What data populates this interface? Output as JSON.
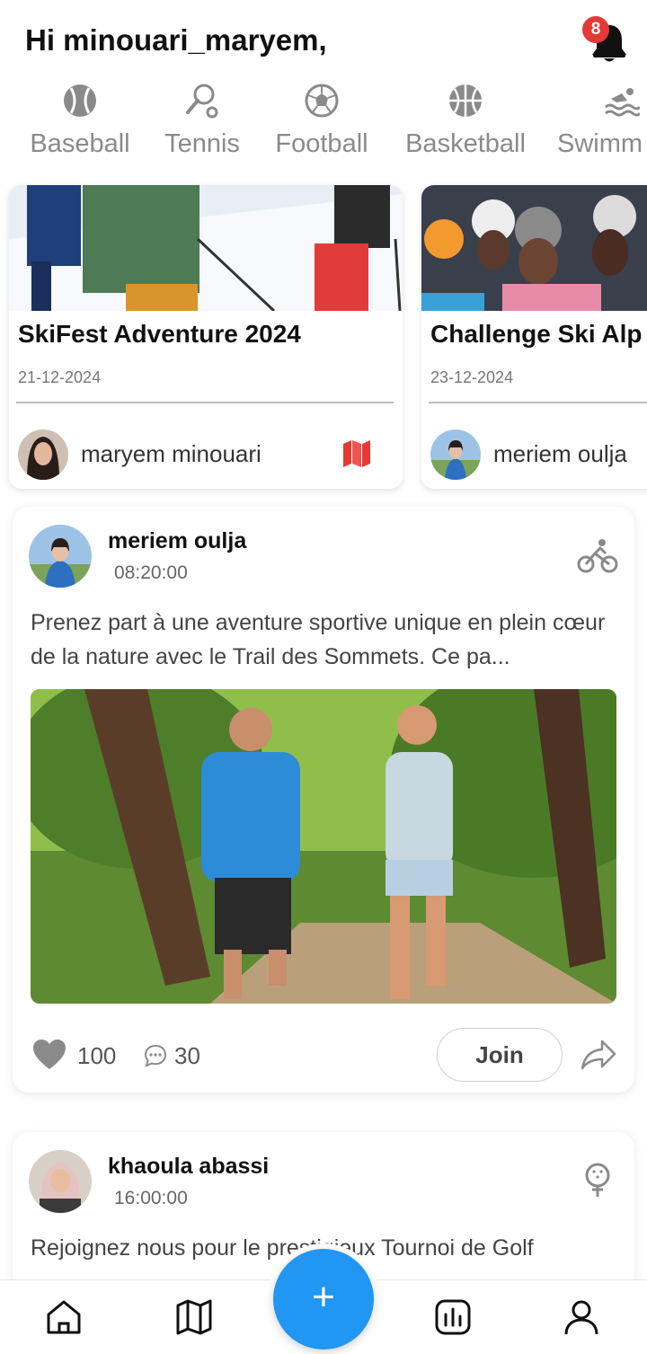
{
  "header": {
    "greeting": "Hi minouari_maryem,",
    "notification_count": "8"
  },
  "sports": [
    {
      "label": "Baseball",
      "icon": "baseball-icon"
    },
    {
      "label": "Tennis",
      "icon": "tennis-icon"
    },
    {
      "label": "Football",
      "icon": "football-icon"
    },
    {
      "label": "Basketball",
      "icon": "basketball-icon"
    },
    {
      "label": "Swimm",
      "icon": "swimming-icon"
    }
  ],
  "events": [
    {
      "title": "SkiFest Adventure 2024",
      "date": "21-12-2024",
      "author": "maryem minouari",
      "icon": "map-icon"
    },
    {
      "title": "Challenge Ski Alp",
      "date": "23-12-2024",
      "author": "meriem oulja"
    }
  ],
  "posts": [
    {
      "author": "meriem oulja",
      "time": "08:20:00",
      "activity_icon": "cycling-icon",
      "text": "Prenez part à une aventure sportive unique en plein cœur de la nature avec le Trail des Sommets. Ce pa...",
      "likes": "100",
      "comments": "30",
      "join_label": "Join"
    },
    {
      "author": "khaoula abassi",
      "time": "16:00:00",
      "activity_icon": "golf-icon",
      "text": "Rejoignez nous pour le prestigieux Tournoi de Golf"
    }
  ],
  "fab_label": "+",
  "nav": [
    "home-icon",
    "map-icon",
    "add-icon",
    "stats-icon",
    "profile-icon"
  ],
  "colors": {
    "accent": "#2196f3",
    "badge": "#e53935",
    "map": "#e53935"
  }
}
